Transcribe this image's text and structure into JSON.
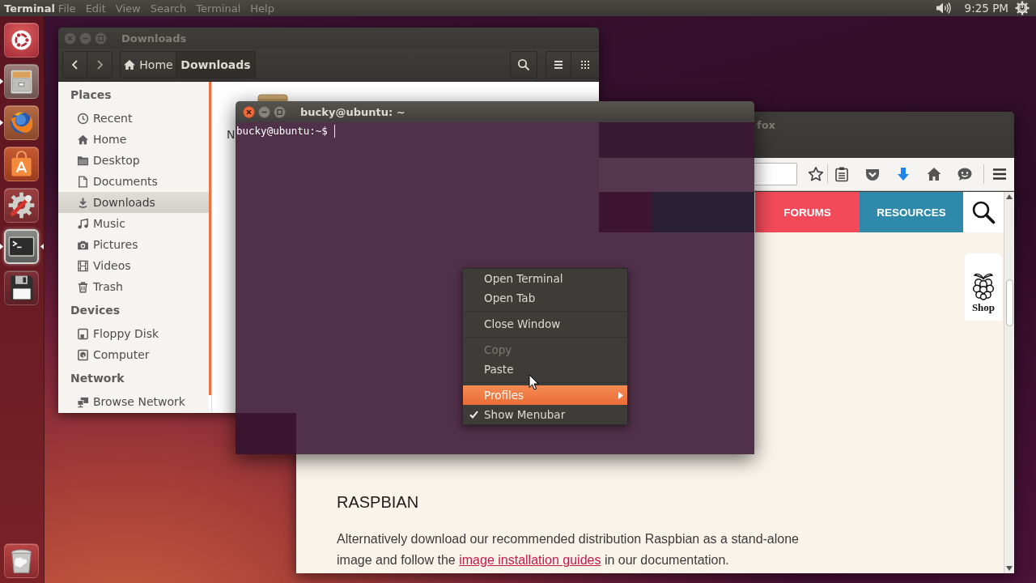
{
  "top_panel": {
    "app_name": "Terminal",
    "menus": [
      "File",
      "Edit",
      "View",
      "Search",
      "Terminal",
      "Help"
    ],
    "clock": "9:25 PM"
  },
  "launcher": {
    "items": [
      {
        "kind": "dash",
        "running": false,
        "focused": false
      },
      {
        "kind": "files",
        "running": true,
        "focused": false
      },
      {
        "kind": "browser",
        "running": true,
        "focused": false
      },
      {
        "kind": "software",
        "running": false,
        "focused": false
      },
      {
        "kind": "settings",
        "running": false,
        "focused": false
      },
      {
        "kind": "terminal",
        "running": true,
        "focused": true
      },
      {
        "kind": "floppy",
        "running": false,
        "focused": false
      }
    ],
    "trash": {
      "kind": "trash",
      "running": false,
      "focused": false
    }
  },
  "file_manager": {
    "active": false,
    "title": "Downloads",
    "path": [
      {
        "kind": "home",
        "label": "Home",
        "selected": false
      },
      {
        "kind": "folder",
        "label": "Downloads",
        "selected": true
      }
    ],
    "sidebar": [
      {
        "heading": "Places",
        "items": [
          {
            "kind": "recent",
            "label": "Recent",
            "selected": false
          },
          {
            "kind": "home",
            "label": "Home",
            "selected": false
          },
          {
            "kind": "desktop",
            "label": "Desktop",
            "selected": false
          },
          {
            "kind": "documents",
            "label": "Documents",
            "selected": false
          },
          {
            "kind": "downloads",
            "label": "Downloads",
            "selected": true
          },
          {
            "kind": "music",
            "label": "Music",
            "selected": false
          },
          {
            "kind": "pictures",
            "label": "Pictures",
            "selected": false
          },
          {
            "kind": "videos",
            "label": "Videos",
            "selected": false
          },
          {
            "kind": "trash",
            "label": "Trash",
            "selected": false
          }
        ]
      },
      {
        "heading": "Devices",
        "items": [
          {
            "kind": "floppy",
            "label": "Floppy Disk",
            "selected": false
          },
          {
            "kind": "computer",
            "label": "Computer",
            "selected": false
          }
        ]
      },
      {
        "heading": "Network",
        "items": [
          {
            "kind": "network",
            "label": "Browse Network",
            "selected": false
          }
        ]
      }
    ],
    "files": [
      {
        "kind": "archive",
        "name": "N"
      }
    ]
  },
  "terminal": {
    "active": true,
    "title": "bucky@ubuntu: ~",
    "prompt": "bucky@ubuntu:~$"
  },
  "context_menu": {
    "items": [
      {
        "kind": "item",
        "label": "Open Terminal",
        "disabled": false,
        "selected": false,
        "checked": false,
        "submenu": false
      },
      {
        "kind": "item",
        "label": "Open Tab",
        "disabled": false,
        "selected": false,
        "checked": false,
        "submenu": false
      },
      {
        "kind": "separator"
      },
      {
        "kind": "item",
        "label": "Close Window",
        "disabled": false,
        "selected": false,
        "checked": false,
        "submenu": false
      },
      {
        "kind": "separator"
      },
      {
        "kind": "item",
        "label": "Copy",
        "disabled": true,
        "selected": false,
        "checked": false,
        "submenu": false
      },
      {
        "kind": "item",
        "label": "Paste",
        "disabled": false,
        "selected": false,
        "checked": false,
        "submenu": false
      },
      {
        "kind": "separator"
      },
      {
        "kind": "item",
        "label": "Profiles",
        "disabled": false,
        "selected": true,
        "checked": false,
        "submenu": true
      },
      {
        "kind": "item",
        "label": "Show Menubar",
        "disabled": false,
        "selected": false,
        "checked": true,
        "submenu": false
      }
    ]
  },
  "browser": {
    "active": false,
    "title": "fox",
    "page": {
      "nav": [
        {
          "label": "FORUMS",
          "color": "#f24a58"
        },
        {
          "label": "RESOURCES",
          "color": "#2f89aa"
        }
      ],
      "shop_tag": "Shop",
      "heading": "RASPBIAN",
      "paragraph": {
        "text": "Alternatively download our recommended distribution Raspbian as a stand-alone image and follow the",
        "link": "image installation guides",
        "after": "in our documentation."
      }
    }
  }
}
